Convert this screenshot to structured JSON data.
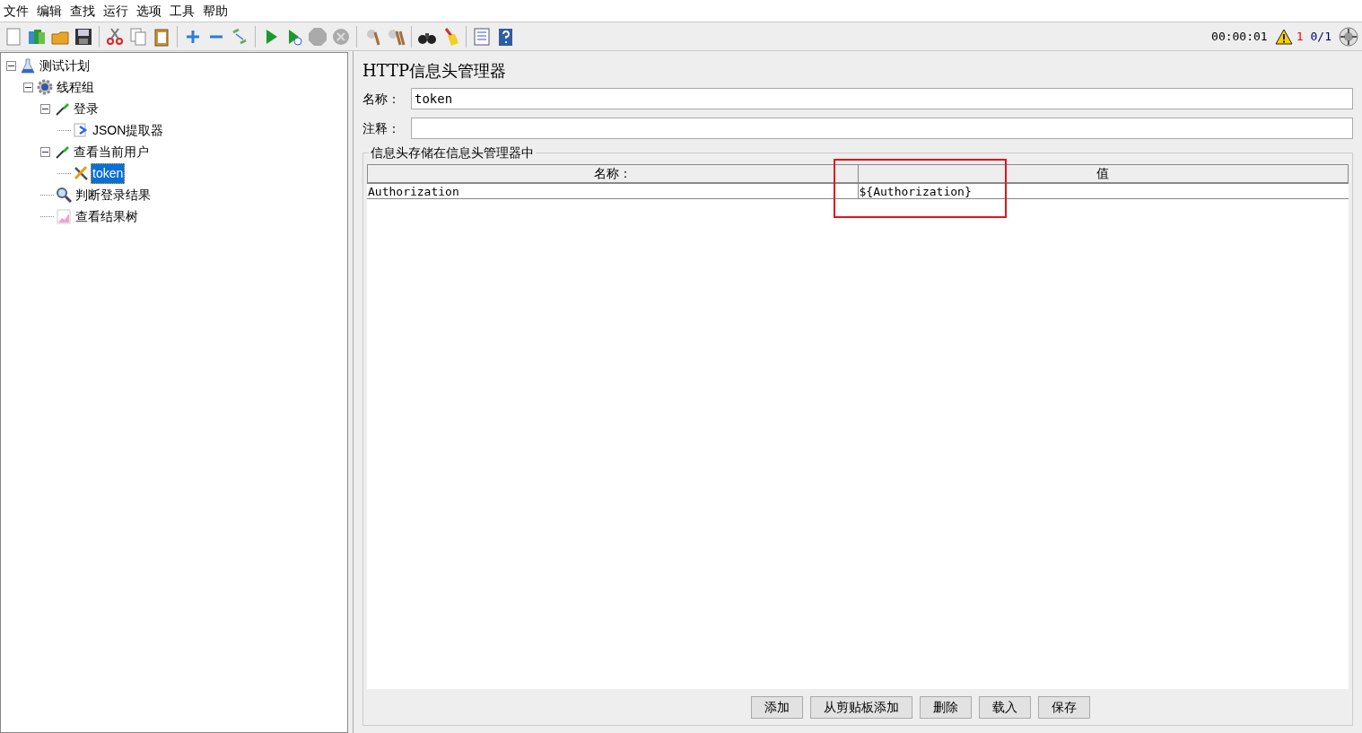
{
  "menu": [
    "文件",
    "编辑",
    "查找",
    "运行",
    "选项",
    "工具",
    "帮助"
  ],
  "status": {
    "timer": "00:00:01",
    "warnings": "1",
    "threads": "0/1"
  },
  "tree": [
    {
      "label": "测试计划",
      "kind": "plan",
      "expanded": true,
      "selected": false,
      "children": [
        {
          "label": "线程组",
          "kind": "gear",
          "expanded": true,
          "selected": false,
          "children": [
            {
              "label": "登录",
              "kind": "sampler",
              "expanded": true,
              "selected": false,
              "children": [
                {
                  "label": "JSON提取器",
                  "kind": "extractor",
                  "selected": false
                }
              ]
            },
            {
              "label": "查看当前用户",
              "kind": "sampler",
              "expanded": true,
              "selected": false,
              "children": [
                {
                  "label": "token",
                  "kind": "tools",
                  "selected": true
                }
              ]
            },
            {
              "label": "判断登录结果",
              "kind": "search",
              "selected": false
            },
            {
              "label": "查看结果树",
              "kind": "chart",
              "selected": false
            }
          ]
        }
      ]
    }
  ],
  "panel": {
    "title": "HTTP信息头管理器",
    "name_label": "名称：",
    "name_value": "token",
    "comment_label": "注释：",
    "group_title": "信息头存储在信息头管理器中",
    "columns": [
      "名称：",
      "值"
    ],
    "rows": [
      [
        "Authorization",
        "${Authorization}"
      ]
    ],
    "buttons": [
      "添加",
      "从剪贴板添加",
      "删除",
      "载入",
      "保存"
    ]
  }
}
